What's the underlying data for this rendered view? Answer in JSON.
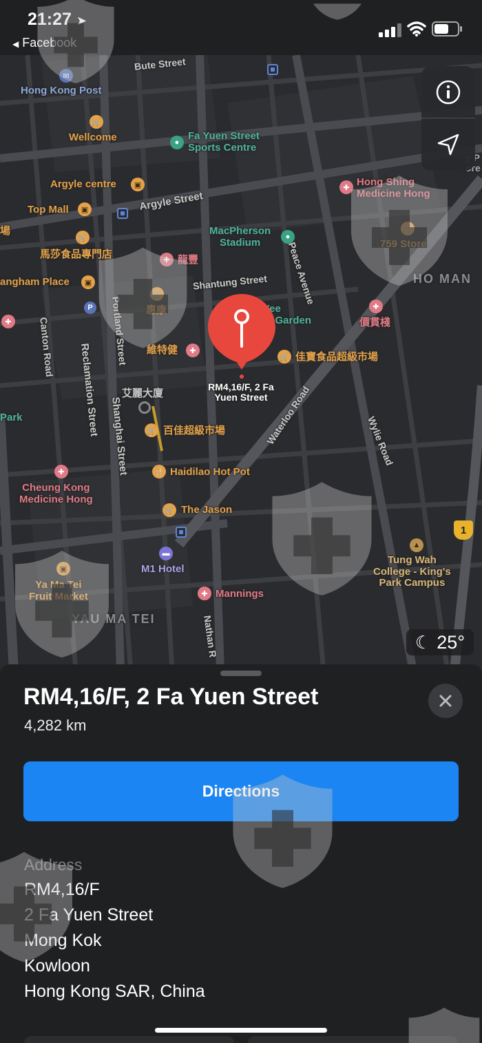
{
  "status_bar": {
    "time": "21:27",
    "back_app": "Facebook"
  },
  "map": {
    "roads": [
      "Bute Street",
      "Argyle Street",
      "Shantung Street",
      "Peace Avenue",
      "Canton Road",
      "Reclamation Street",
      "Shanghai Street",
      "Portland Street",
      "Waterloo Road",
      "Wylie Road",
      "Nathan R"
    ],
    "pois": {
      "hong_kong_post": "Hong Kong Post",
      "wellcome": "Wellcome",
      "fa_yuen_sports": "Fa Yuen Street\nSports Centre",
      "argyle_centre": "Argyle centre",
      "top_mall": "Top Mall",
      "masa_shop": "馬莎食品專門店",
      "langham_place": "angham Place",
      "macpherson": "MacPherson\nStadium",
      "hong_shing": "Hong Shing\nMedicine Hong",
      "store_759": "759 Store",
      "district_ho_man": "HO MAN",
      "lung_fung": "龍豐",
      "wai_hong": "惠康",
      "wai_tak_kin": "維特健",
      "yee_garden": "Yee\net Garden",
      "ka_bo": "佳寶食品超級市場",
      "value_shop": "價貫棧",
      "ngai_lai": "艾麗大廈",
      "baijia": "百佳超級市場",
      "park": "Park",
      "cheung_kong": "Cheung Kong\nMedicine Hong",
      "haidilao": "Haidilao Hot Pot",
      "the_jason": "The Jason",
      "m1_hotel": "M1 Hotel",
      "fruit_market": "Ya Ma Tei\nFruit Market",
      "district_yau_ma_tei": "YAU MA TEI",
      "mannings": "Mannings",
      "tung_wah": "Tung Wah\nCollege - King's\nPark Campus",
      "edge_right": "y P\nore",
      "edge_left_1": "場"
    },
    "pin_label": "RM4,16/F, 2 Fa\nYuen Street",
    "route_shield": "1",
    "weather": {
      "temp": "25°",
      "icon": "moon-icon"
    }
  },
  "sheet": {
    "title": "RM4,16/F, 2 Fa Yuen Street",
    "distance": "4,282 km",
    "directions_label": "Directions",
    "address_label": "Address",
    "address_lines": [
      "RM4,16/F",
      "2 Fa Yuen Street",
      "Mong Kok",
      "Kowloon",
      "Hong Kong SAR, China"
    ]
  },
  "colors": {
    "accent": "#1b85f3",
    "pin": "#e8473e",
    "map_bg": "#2a2b2e",
    "sheet_bg": "#1f2022"
  }
}
